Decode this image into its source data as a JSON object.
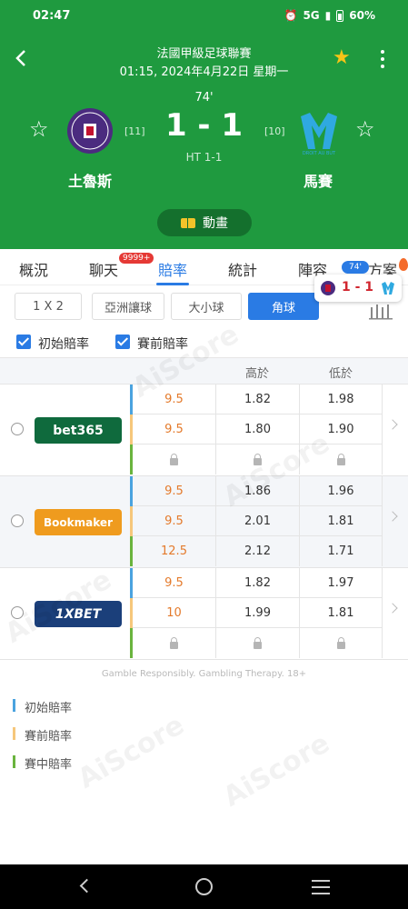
{
  "status_bar": {
    "time": "02:47",
    "network": "5G",
    "battery": "60%"
  },
  "match": {
    "league": "法國甲級足球聯賽",
    "datetime": "01:15, 2024年4月22日 星期一",
    "minute": "74'",
    "score": "1 - 1",
    "half_time": "HT 1-1",
    "home": {
      "name": "土魯斯",
      "rank": "[11]",
      "logo_text": "TOULOUSE"
    },
    "away": {
      "name": "馬賽",
      "rank": "[10]",
      "logo_text": "M"
    },
    "animation_label": "動畫"
  },
  "tabs": [
    {
      "label": "概況"
    },
    {
      "label": "聊天"
    },
    {
      "label": "賠率"
    },
    {
      "label": "統計"
    },
    {
      "label": "陣容"
    },
    {
      "label": "方案"
    }
  ],
  "chat_badge": "9999+",
  "floating_score": {
    "minute": "74'",
    "score": "1 - 1"
  },
  "markets": [
    {
      "label": "1 X 2"
    },
    {
      "label": "亞洲讓球"
    },
    {
      "label": "大小球"
    },
    {
      "label": "角球"
    }
  ],
  "filters": {
    "initial_odds": "初始賠率",
    "pre_match_odds": "賽前賠率"
  },
  "table_header": {
    "over": "高於",
    "under": "低於"
  },
  "bookmakers": [
    {
      "name": "bet365",
      "rows": [
        {
          "line": "9.5",
          "over": "1.82",
          "under": "1.98"
        },
        {
          "line": "9.5",
          "over": "1.80",
          "under": "1.90"
        },
        {
          "line": "",
          "over": "",
          "under": ""
        }
      ]
    },
    {
      "name": "Bookmaker",
      "rows": [
        {
          "line": "9.5",
          "over": "1.86",
          "under": "1.96"
        },
        {
          "line": "9.5",
          "over": "2.01",
          "under": "1.81"
        },
        {
          "line": "12.5",
          "over": "2.12",
          "under": "1.71"
        }
      ]
    },
    {
      "name": "1XBET",
      "rows": [
        {
          "line": "9.5",
          "over": "1.82",
          "under": "1.97"
        },
        {
          "line": "10",
          "over": "1.99",
          "under": "1.81"
        },
        {
          "line": "",
          "over": "",
          "under": ""
        }
      ]
    }
  ],
  "gamble_notice": "Gamble Responsibly. Gambling Therapy. 18+",
  "legend": [
    {
      "label": "初始賠率",
      "color": "#4aa3df"
    },
    {
      "label": "賽前賠率",
      "color": "#f6c77b"
    },
    {
      "label": "賽中賠率",
      "color": "#6ab43e"
    }
  ],
  "watermark": "AiScore",
  "colors": {
    "header_green": "#1f9a3f",
    "accent_blue": "#2a7be4",
    "odds_orange": "#e47a2b"
  }
}
